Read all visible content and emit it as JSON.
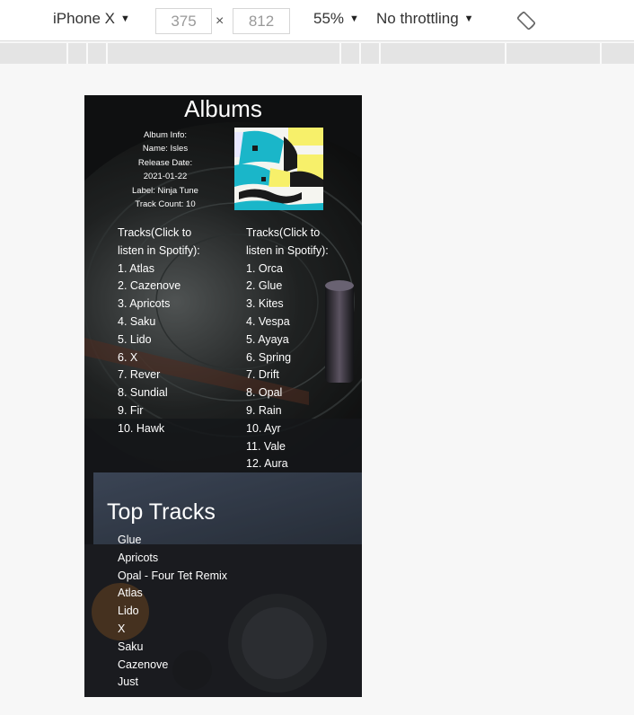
{
  "devtools": {
    "device": "iPhone X",
    "width": "375",
    "height": "812",
    "zoom": "55%",
    "throttling": "No throttling",
    "dim_separator": "×"
  },
  "page": {
    "title": "Albums",
    "album_info": {
      "heading": "Album Info:",
      "name": "Name: Isles",
      "release_label": "Release Date:",
      "release_date": "2021-01-22",
      "label": "Label: Ninja Tune",
      "track_count": "Track Count: 10"
    },
    "tracks_left": {
      "header": "Tracks(Click to listen in Spotify):",
      "items": [
        "1. Atlas",
        "2. Cazenove",
        "3. Apricots",
        "4. Saku",
        "5. Lido",
        "6. X",
        "7. Rever",
        "8. Sundial",
        "9. Fir",
        "10. Hawk"
      ]
    },
    "tracks_right": {
      "header": "Tracks(Click to listen in Spotify):",
      "items": [
        "1. Orca",
        "2. Glue",
        "3. Kites",
        "4. Vespa",
        "5. Ayaya",
        "6. Spring",
        "7. Drift",
        "8. Opal",
        "9. Rain",
        "10. Ayr",
        "11. Vale",
        "12. Aura"
      ]
    },
    "top_tracks": {
      "title": "Top Tracks",
      "items": [
        "Glue",
        "Apricots",
        "Opal - Four Tet Remix",
        "Atlas",
        "Lido",
        "X",
        "Saku",
        "Cazenove",
        "Just"
      ]
    }
  }
}
